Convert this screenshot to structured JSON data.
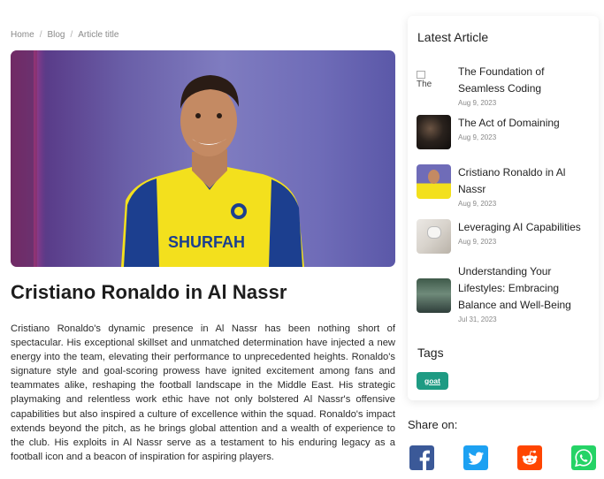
{
  "breadcrumb": {
    "home": "Home",
    "sep": "/",
    "blog": "Blog",
    "current": "Article title"
  },
  "article": {
    "title": "Cristiano Ronaldo in Al Nassr",
    "body": "Cristiano Ronaldo's dynamic presence in Al Nassr has been nothing short of spectacular. His exceptional skillset and unmatched determination have injected a new energy into the team, elevating their performance to unprecedented heights. Ronaldo's signature style and goal-scoring prowess have ignited excitement among fans and teammates alike, reshaping the football landscape in the Middle East. His strategic playmaking and relentless work ethic have not only bolstered Al Nassr's offensive capabilities but also inspired a culture of excellence within the squad. Ronaldo's impact extends beyond the pitch, as he brings global attention and a wealth of experience to the club. His exploits in Al Nassr serve as a testament to his enduring legacy as a football icon and a beacon of inspiration for aspiring players.",
    "hero_sponsor": "SHURFAH"
  },
  "sidebar": {
    "heading": "Latest Article",
    "items": [
      {
        "title": "The Foundation of Seamless Coding",
        "date": "Aug 9, 2023",
        "thumb_alt": "The",
        "thumb": "broken-image-icon"
      },
      {
        "title": "The Act of Domaining",
        "date": "Aug 9, 2023",
        "thumb": "dark-tech-thumbnail"
      },
      {
        "title": "Cristiano Ronaldo in Al Nassr",
        "date": "Aug 9, 2023",
        "thumb": "player-thumbnail"
      },
      {
        "title": "Leveraging AI Capabilities",
        "date": "Aug 9, 2023",
        "thumb": "robot-thumbnail"
      },
      {
        "title": "Understanding Your Lifestyles: Embracing Balance and Well-Being",
        "date": "Jul 31, 2023",
        "thumb": "lake-thumbnail"
      }
    ],
    "tags_heading": "Tags",
    "tags": [
      "goat"
    ]
  },
  "share": {
    "heading": "Share on:",
    "icons": [
      "facebook-icon",
      "twitter-icon",
      "reddit-icon",
      "whatsapp-icon"
    ],
    "colors": {
      "facebook": "#3b5998",
      "twitter": "#1da1f2",
      "reddit": "#ff4500",
      "whatsapp": "#25d366"
    }
  },
  "colors": {
    "tag_bg": "#1e9b83",
    "hero_bg": "#6f6cb8"
  }
}
